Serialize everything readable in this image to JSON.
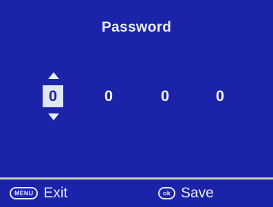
{
  "title": "Password",
  "digits": [
    "0",
    "0",
    "0",
    "0"
  ],
  "selected_index": 0,
  "footer": {
    "exit": {
      "key": "MENU",
      "label": "Exit"
    },
    "save": {
      "key": "ok",
      "label": "Save"
    }
  },
  "colors": {
    "background": "#1b23a8",
    "text": "#e8eef8",
    "selected_bg": "#dfe7f2",
    "divider": "#c8d8b0"
  },
  "icons": [
    "arrow-up-icon",
    "arrow-down-icon",
    "menu-key-icon",
    "ok-key-icon"
  ]
}
